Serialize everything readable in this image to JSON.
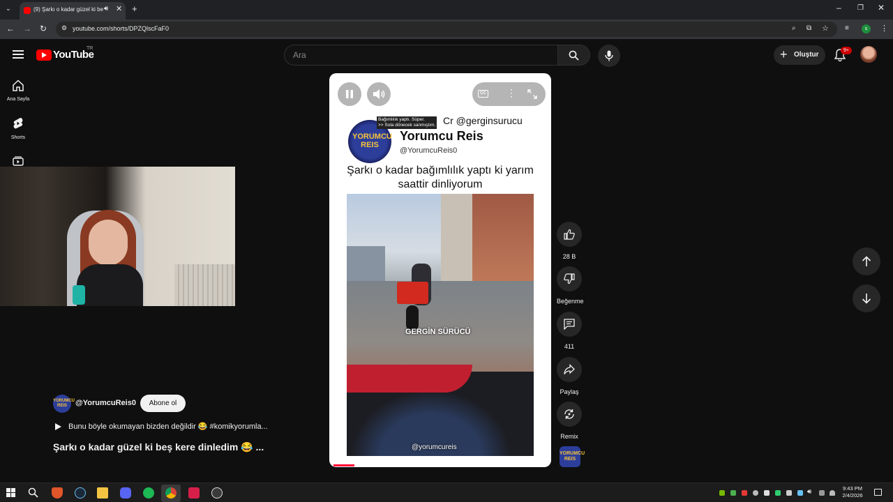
{
  "browser": {
    "tab_title": "(9) Şarkı o kadar güzel ki be",
    "url": "youtube.com/shorts/DPZQlscFaF0"
  },
  "header": {
    "logo_text": "YouTube",
    "region": "TR",
    "search_placeholder": "Ara",
    "create_label": "Oluştur",
    "notification_count": "9+"
  },
  "sidebar": {
    "items": [
      {
        "label": "Ana Sayfa",
        "icon": "home-icon"
      },
      {
        "label": "Shorts",
        "icon": "shorts-icon"
      },
      {
        "label": "",
        "icon": "subscriptions-icon"
      }
    ]
  },
  "video": {
    "overlay_note": "Bağımlılık yaptı. Süper.\n>> Sola dönecek sanmıştım.",
    "credit": "Cr @gerginsurucu",
    "channel_title": "Yorumcu Reis",
    "channel_handle": "@YorumcuReis0",
    "logo_text": "YORUMCU REIS",
    "caption": "Şarkı o kadar bağımlılık yaptı ki yarım saattir dinliyorum",
    "watermark": "GERGİN SÜRÜCÜ",
    "watermark_handle": "@yorumcureis"
  },
  "actions": {
    "likes": "28 B",
    "dislike_label": "Beğenme",
    "comments": "411",
    "share_label": "Paylaş",
    "remix_label": "Remix"
  },
  "meta": {
    "handle": "@YorumcuReis0",
    "subscribe_label": "Abone ol",
    "description": "Bunu böyle okumayan bizden değildir 😂 #komikyorumla...",
    "title": "Şarkı o kadar güzel ki beş kere dinledim 😂 ..."
  },
  "taskbar": {
    "time": "9:43 PM",
    "date": "2/4/2026"
  },
  "colors": {
    "brand_red": "#ff0000",
    "background": "#0f0f0f",
    "surface": "#272727"
  }
}
